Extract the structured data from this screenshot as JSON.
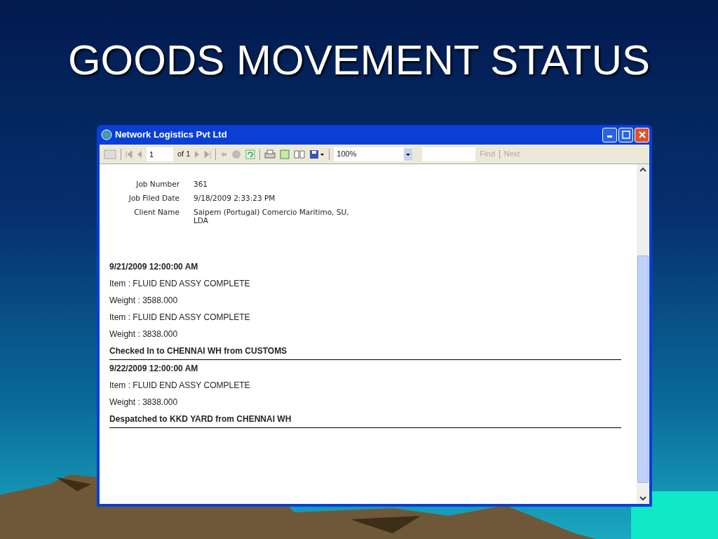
{
  "slide": {
    "title": "GOODS MOVEMENT STATUS"
  },
  "window": {
    "title": "Network Logistics Pvt Ltd"
  },
  "toolbar": {
    "page_number": "1",
    "page_count": "of 1",
    "zoom": "100%",
    "find": {
      "label": "Find",
      "disabled": true
    },
    "next": {
      "label": "Next",
      "disabled": true
    }
  },
  "header_fields": [
    {
      "label": "Job Number",
      "value": "361"
    },
    {
      "label": "Job Filed Date",
      "value": "9/18/2009 2:33:23 PM"
    },
    {
      "label": "Client Name",
      "value": "Saipem (Portugal) Comercio Maritimo, SU, LDA"
    }
  ],
  "movements": [
    {
      "date": "9/21/2009 12:00:00 AM",
      "lines": [
        "Item  : FLUID END ASSY COMPLETE",
        "Weight  : 3588.000",
        "Item  : FLUID END ASSY COMPLETE",
        "Weight  : 3838.000"
      ],
      "status": "Checked In to CHENNAI WH from CUSTOMS"
    },
    {
      "date": "9/22/2009 12:00:00 AM",
      "lines": [
        "Item  : FLUID END ASSY COMPLETE",
        "Weight  : 3838.000"
      ],
      "status": "Despatched to KKD YARD from CHENNAI WH"
    }
  ]
}
